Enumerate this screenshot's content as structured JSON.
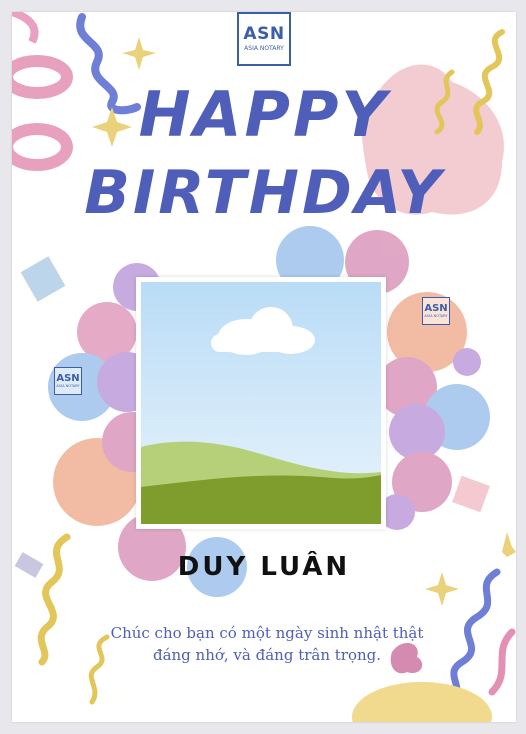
{
  "logo": {
    "brand": "ASN",
    "subtitle": "ASIA NOTARY"
  },
  "title": {
    "line1": "HAPPY",
    "line2": "BIRTHDAY"
  },
  "name": "DUY LUÂN",
  "message": "Chúc cho bạn có một ngày sinh nhật thật đáng nhớ, và đáng trân trọng.",
  "colors": {
    "title": "#4f5eb8",
    "brand": "#3c5ea8",
    "name": "#111111",
    "background": "#ffffff"
  },
  "icons": [
    "party-streamer-icon",
    "star-icon",
    "balloon-icon",
    "photo-placeholder-icon",
    "cloud-icon",
    "hill-icon"
  ]
}
